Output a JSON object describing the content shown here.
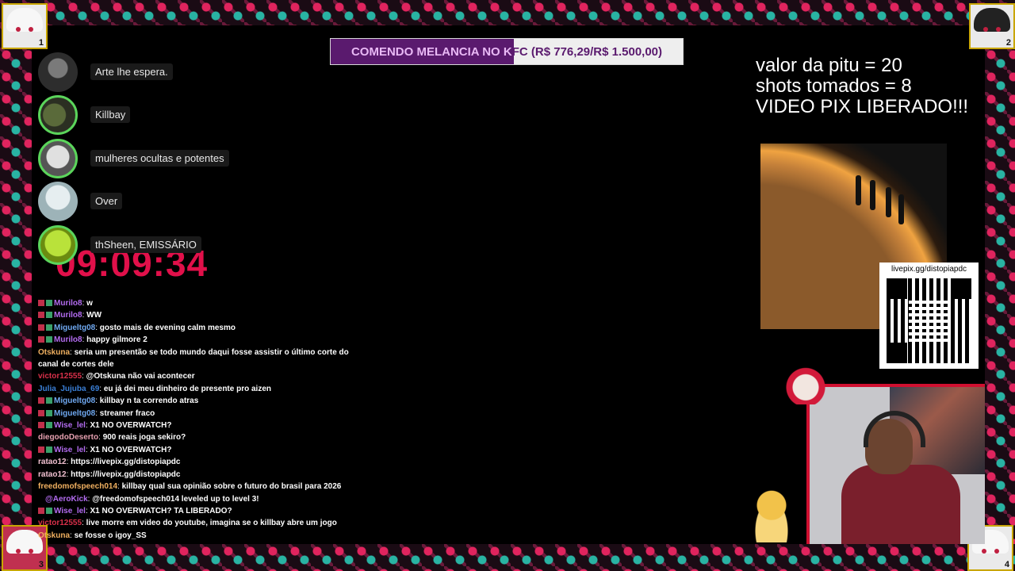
{
  "goal": {
    "title": "COMENDO MELANCIA NO KFC",
    "amounts": "(R$ 776,29/R$ 1.500,00)",
    "progress_fraction": 0.5175
  },
  "notes": [
    "valor da pitu = 20",
    "shots tomados = 8",
    "VIDEO PIX LIBERADO!!!"
  ],
  "voice_channel": [
    {
      "name": "Arte lhe espera."
    },
    {
      "name": "Killbay"
    },
    {
      "name": "mulheres ocultas e potentes"
    },
    {
      "name": "Over"
    },
    {
      "name": "thSheen, EMISSÁRIO"
    }
  ],
  "clock": "09:09:34",
  "chat": [
    {
      "user": "Murilo8",
      "text": "w",
      "color": "#b36cf0",
      "badges": true
    },
    {
      "user": "Murilo8",
      "text": "WW",
      "color": "#b36cf0",
      "badges": true
    },
    {
      "user": "Migueltg08",
      "text": "gosto mais de evening calm mesmo",
      "color": "#6fa8f0",
      "badges": true
    },
    {
      "user": "Murilo8",
      "text": "happy gilmore 2",
      "color": "#b36cf0",
      "badges": true
    },
    {
      "user": "Otskuna",
      "text": "seria um presentão se todo mundo daqui fosse assistir o último corte do canal de cortes dele",
      "color": "#f0b060",
      "badges": false
    },
    {
      "user": "victor12555",
      "text": "@Otskuna não vai acontecer",
      "color": "#d9304a",
      "badges": false
    },
    {
      "user": "Julia_Jujuba_69",
      "text": "eu já dei meu dinheiro de presente pro aizen",
      "color": "#3a7fd6",
      "badges": false
    },
    {
      "user": "Migueltg08",
      "text": "killbay n ta correndo atras",
      "color": "#6fa8f0",
      "badges": true
    },
    {
      "user": "Migueltg08",
      "text": "streamer fraco",
      "color": "#6fa8f0",
      "badges": true
    },
    {
      "user": "Wise_lel",
      "text": "X1 NO OVERWATCH?",
      "color": "#b36cf0",
      "badges": true
    },
    {
      "user": "diegodoDeserto",
      "text": "900 reais joga sekiro?",
      "color": "#e6a0b0",
      "badges": false
    },
    {
      "user": "Wise_lel",
      "text": "X1 NO OVERWATCH?",
      "color": "#b36cf0",
      "badges": true
    },
    {
      "user": "ratao12",
      "text": "https://livepix.gg/distopiapdc",
      "color": "#f0c0d0",
      "badges": false
    },
    {
      "user": "ratao12",
      "text": "https://livepix.gg/distopiapdc",
      "color": "#f0c0d0",
      "badges": false
    },
    {
      "user": "freedomofspeech014",
      "text": "killbay qual sua opinião sobre o futuro do brasil para 2026",
      "color": "#f0b060",
      "badges": false
    },
    {
      "user": "@AeroKick",
      "text": "@freedomofspeech014 leveled up to level 3!",
      "color": "#b36cf0",
      "badges": false,
      "system": true
    },
    {
      "user": "Wise_lel",
      "text": "X1 NO OVERWATCH? TA LIBERADO?",
      "color": "#b36cf0",
      "badges": true
    },
    {
      "user": "victor12555",
      "text": "live morre em video do youtube, imagina se o killbay abre um jogo",
      "color": "#d9304a",
      "badges": false
    },
    {
      "user": "Otskuna",
      "text": "se fosse o igoy_SS",
      "color": "#f0b060",
      "badges": false
    }
  ],
  "qr": {
    "url": "livepix.gg/distopiapdc"
  },
  "corners": {
    "tl": "1",
    "tr": "2",
    "bl": "3",
    "br": "4"
  },
  "colors": {
    "accent_red": "#d01030",
    "goal_purple": "#5a1a6e",
    "clock": "#e1104a"
  }
}
